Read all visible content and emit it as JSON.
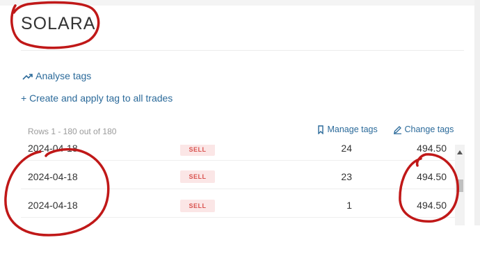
{
  "page": {
    "title": "SOLARA",
    "analyse_tags": "Analyse tags",
    "create_tag": "+ Create and apply tag to all trades",
    "rows_info": "Rows 1 - 180 out of 180",
    "manage_tags": "Manage tags",
    "change_tags": "Change tags"
  },
  "table": {
    "rows": [
      {
        "date": "2024-04-18",
        "side": "SELL",
        "qty": "24",
        "price": "494.50"
      },
      {
        "date": "2024-04-18",
        "side": "SELL",
        "qty": "23",
        "price": "494.50"
      },
      {
        "date": "2024-04-18",
        "side": "SELL",
        "qty": "1",
        "price": "494.50"
      },
      {
        "date": "",
        "side": "",
        "qty": "",
        "price": ""
      }
    ]
  },
  "colors": {
    "link": "#2b6a9a",
    "sell_badge_bg": "#fbe6e6",
    "sell_badge_text": "#d9534f",
    "annotation": "#c01818"
  },
  "icons": {
    "analyse": "trend-up-icon",
    "manage": "bookmark-icon",
    "change": "pencil-icon",
    "scroll_up": "triangle-up-icon"
  }
}
